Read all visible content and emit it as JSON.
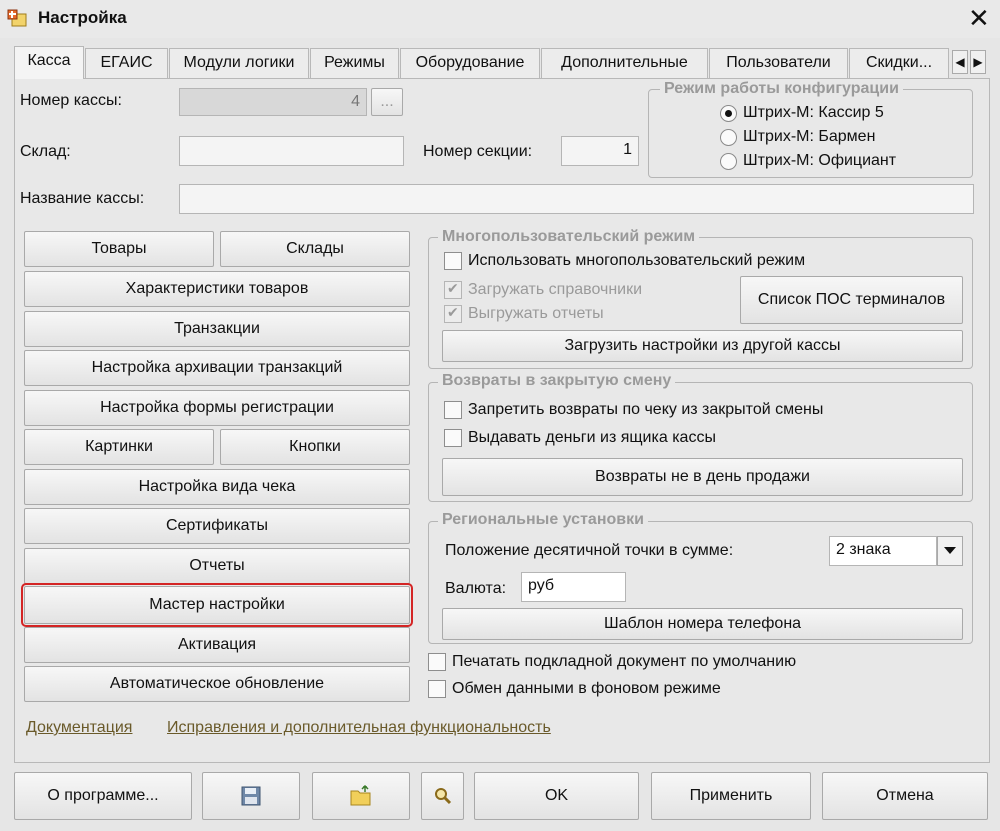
{
  "window": {
    "title": "Настройка"
  },
  "tabs": [
    "Касса",
    "ЕГАИС",
    "Модули логики",
    "Режимы",
    "Оборудование",
    "Дополнительные",
    "Пользователи",
    "Скидки..."
  ],
  "fields": {
    "register_number_label": "Номер кассы:",
    "register_number_value": "4",
    "register_number_btn": "...",
    "warehouse_label": "Склад:",
    "warehouse_value": "",
    "section_label": "Номер секции:",
    "section_value": "1",
    "register_name_label": "Название кассы:",
    "register_name_value": ""
  },
  "config_mode": {
    "title": "Режим работы конфигурации",
    "options": [
      "Штрих-М: Кассир 5",
      "Штрих-М: Бармен",
      "Штрих-М: Официант"
    ],
    "selected": 0
  },
  "left_buttons": {
    "goods": "Товары",
    "warehouses": "Склады",
    "goods_characteristics": "Характеристики товаров",
    "transactions": "Транзакции",
    "archive_settings": "Настройка архивации транзакций",
    "registration_form": "Настройка формы регистрации",
    "pictures": "Картинки",
    "buttons": "Кнопки",
    "receipt_view": "Настройка вида чека",
    "certificates": "Сертификаты",
    "reports": "Отчеты",
    "setup_wizard": "Мастер настройки",
    "activation": "Активация",
    "auto_update": "Автоматическое обновление"
  },
  "multiuser": {
    "title": "Многопользовательский режим",
    "use_multiuser": "Использовать многопользовательский режим",
    "load_refs": "Загружать справочники",
    "upload_reports": "Выгружать отчеты",
    "pos_list": "Список ПОС терминалов",
    "load_from_other": "Загрузить настройки из другой кассы"
  },
  "returns": {
    "title": "Возвраты в закрытую смену",
    "forbid_returns": "Запретить возвраты по чеку из закрытой смены",
    "give_money": "Выдавать деньги из ящика кассы",
    "returns_other_day": "Возвраты не в день продажи"
  },
  "regional": {
    "title": "Региональные установки",
    "decimal_label": "Положение десятичной точки в сумме:",
    "decimal_value": "2 знака",
    "currency_label": "Валюта:",
    "currency_value": "руб",
    "phone_template": "Шаблон номера телефона"
  },
  "bottom_checks": {
    "print_doc": "Печатать подкладной документ по умолчанию",
    "bg_exchange": "Обмен данными в фоновом режиме"
  },
  "links": {
    "documentation": "Документация",
    "fixes": "Исправления и дополнительная функциональность"
  },
  "footer": {
    "about": "О программе...",
    "ok": "OK",
    "apply": "Применить",
    "cancel": "Отмена"
  },
  "colors": {
    "highlight": "#d42525",
    "group_title": "#9a9a9a",
    "link": "#6a5a2a"
  }
}
